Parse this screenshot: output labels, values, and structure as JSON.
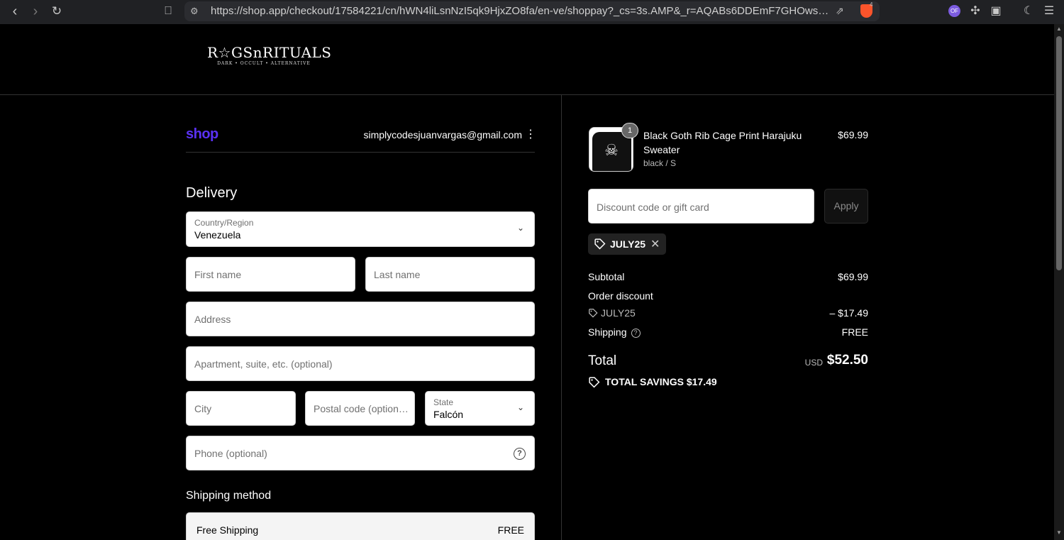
{
  "browser": {
    "url": "https://shop.app/checkout/17584221/cn/hWN4liLsnNzI5qk9HjxZO8fa/en-ve/shoppay?_cs=3s.AMP&_r=AQABs6DDEmF7GHOwsTlr-IwvCVM4G...",
    "extension_badge": "4",
    "purple_ext_label": "OF"
  },
  "store": {
    "logo_main": "R☆GSnRITUALS",
    "logo_sub": "DARK • OCCULT • ALTERNATIVE"
  },
  "account": {
    "shop_logo": "shop",
    "email": "simplycodesjuanvargas@gmail.com"
  },
  "delivery": {
    "title": "Delivery",
    "country": {
      "label": "Country/Region",
      "value": "Venezuela"
    },
    "first_name_placeholder": "First name",
    "last_name_placeholder": "Last name",
    "address_placeholder": "Address",
    "apartment_placeholder": "Apartment, suite, etc. (optional)",
    "city_placeholder": "City",
    "postal_placeholder": "Postal code (option…",
    "state": {
      "label": "State",
      "value": "Falcón"
    },
    "phone_placeholder": "Phone (optional)"
  },
  "shipping_method": {
    "title": "Shipping method",
    "option_name": "Free Shipping",
    "option_price": "FREE"
  },
  "cart": {
    "item": {
      "quantity": "1",
      "name": "Black Goth Rib Cage Print Harajuku Sweater",
      "variant": "black / S",
      "price": "$69.99"
    },
    "discount_placeholder": "Discount code or gift card",
    "apply_label": "Apply",
    "applied_code": "JULY25"
  },
  "summary": {
    "subtotal_label": "Subtotal",
    "subtotal_value": "$69.99",
    "order_discount_label": "Order discount",
    "discount_code": "JULY25",
    "discount_value": "– $17.49",
    "shipping_label": "Shipping",
    "shipping_value": "FREE",
    "total_label": "Total",
    "currency": "USD",
    "total_value": "$52.50",
    "savings_text": "TOTAL SAVINGS  $17.49"
  }
}
